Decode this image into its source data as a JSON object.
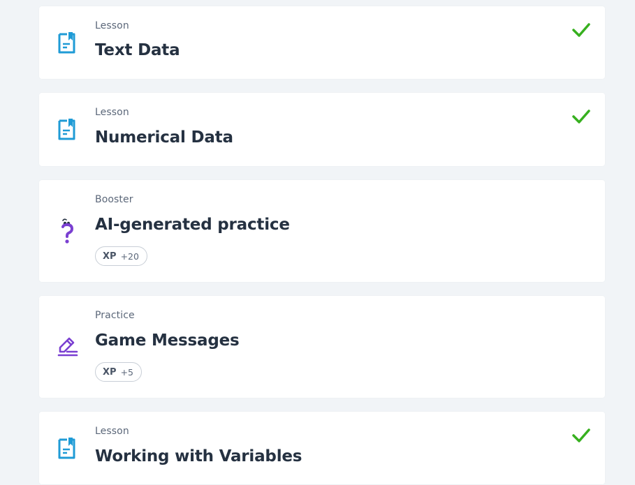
{
  "colors": {
    "lesson_icon": "#1f9bd6",
    "booster_icon": "#7a3fd1",
    "practice_icon": "#7a3fd1",
    "check": "#37b01f",
    "title": "#253141",
    "label": "#5b6779",
    "background": "#f1f4f7"
  },
  "items": [
    {
      "type": "Lesson",
      "title": "Text Data",
      "icon": "document-bookmark-icon",
      "completed": true
    },
    {
      "type": "Lesson",
      "title": "Numerical Data",
      "icon": "document-bookmark-icon",
      "completed": true
    },
    {
      "type": "Booster",
      "title": "AI-generated practice",
      "icon": "question-mark-character-icon",
      "completed": false,
      "xp_label": "XP",
      "xp_value": "+20"
    },
    {
      "type": "Practice",
      "title": "Game Messages",
      "icon": "pencil-lines-icon",
      "completed": false,
      "xp_label": "XP",
      "xp_value": "+5"
    },
    {
      "type": "Lesson",
      "title": "Working with Variables",
      "icon": "document-bookmark-icon",
      "completed": true
    }
  ]
}
